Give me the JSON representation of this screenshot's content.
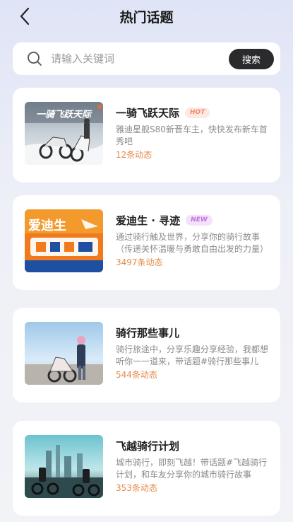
{
  "header": {
    "title": "热门话题"
  },
  "search": {
    "placeholder": "请输入关键词",
    "value": "",
    "button_label": "搜索"
  },
  "topics": [
    {
      "title": "一骑飞跃天际",
      "badge": "HOT",
      "description": "雅迪星舰S80新晋车主，快快发布新车首秀吧",
      "count": "12条动态",
      "thumb_text": "一骑飞跃天际"
    },
    {
      "title": "爱迪生 · 寻迹",
      "badge": "NEW",
      "description": "通过骑行触及世界，分享你的骑行故事（传递关怀温暖与勇敢自由出发的力量）",
      "count": "3497条动态",
      "thumb_text": "爱迪生"
    },
    {
      "title": "骑行那些事儿",
      "badge": "",
      "description": "骑行旅途中，分享乐趣分享经验，我都想听你一一道来，带话题#骑行那些事儿",
      "count": "544条动态"
    },
    {
      "title": "飞越骑行计划",
      "badge": "",
      "description": "城市骑行，即刻飞越！带话题#飞越骑行计划，和车友分享你的城市骑行故事",
      "count": "353条动态"
    }
  ]
}
